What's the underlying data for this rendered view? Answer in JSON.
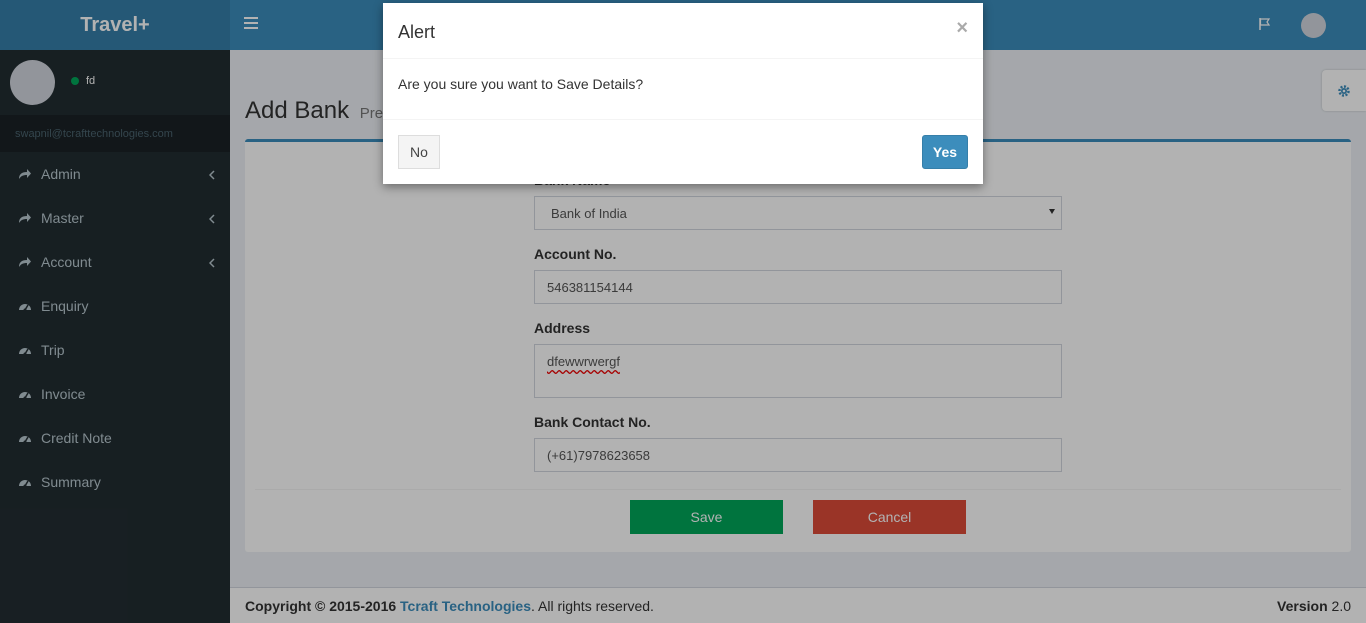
{
  "app": {
    "title": "Travel+"
  },
  "sidebar": {
    "user_name": "fd",
    "email": "swapnil@tcrafttechnologies.com",
    "items": [
      {
        "label": "Admin",
        "icon": "share-icon",
        "has_submenu": true
      },
      {
        "label": "Master",
        "icon": "share-icon",
        "has_submenu": true
      },
      {
        "label": "Account",
        "icon": "share-icon",
        "has_submenu": true
      },
      {
        "label": "Enquiry",
        "icon": "dashboard-icon",
        "has_submenu": false
      },
      {
        "label": "Trip",
        "icon": "dashboard-icon",
        "has_submenu": false
      },
      {
        "label": "Invoice",
        "icon": "dashboard-icon",
        "has_submenu": false
      },
      {
        "label": "Credit Note",
        "icon": "dashboard-icon",
        "has_submenu": false
      },
      {
        "label": "Summary",
        "icon": "dashboard-icon",
        "has_submenu": false
      }
    ]
  },
  "page": {
    "title": "Add Bank",
    "subtitle": "Previ"
  },
  "form": {
    "bank_name_label": "Bank Name",
    "bank_name_value": "Bank of India",
    "account_label": "Account No.",
    "account_value": "546381154144",
    "address_label": "Address",
    "address_value": "dfewwrwergf",
    "contact_label": "Bank Contact No.",
    "contact_value": "(+61)7978623658",
    "save_label": "Save",
    "cancel_label": "Cancel"
  },
  "footer": {
    "copyright_prefix": "Copyright © 2015-2016 ",
    "company": "Tcraft Technologies",
    "copyright_suffix": ". All rights reserved.",
    "version_label": "Version",
    "version_value": "2.0"
  },
  "modal": {
    "title": "Alert",
    "close": "×",
    "message": "Are you sure you want to Save Details?",
    "no_label": "No",
    "yes_label": "Yes"
  },
  "colors": {
    "header": "#3c8dbc",
    "logo": "#367fa9",
    "sidebar": "#222d32",
    "save": "#00a65a",
    "cancel": "#dd4b39"
  }
}
